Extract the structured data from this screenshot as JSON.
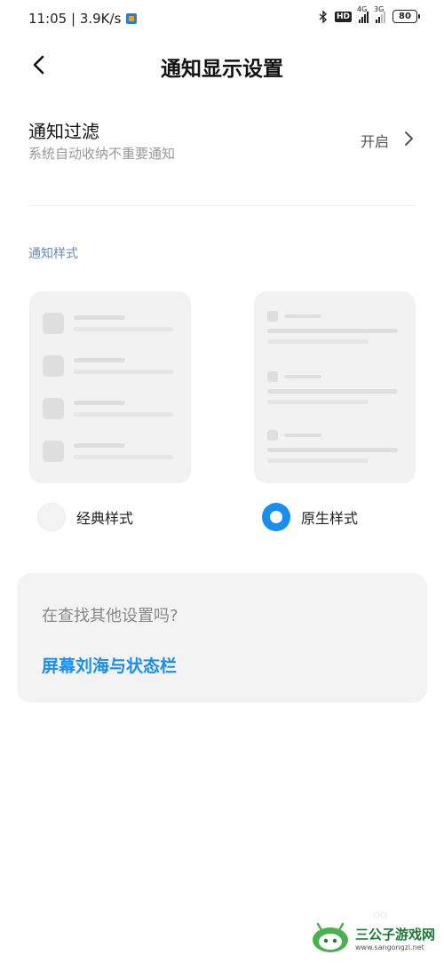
{
  "status_bar": {
    "time_speed": "11:05 | 3.9K/s",
    "hd": "HD",
    "net1": "4G",
    "net2": "3G",
    "battery": "80"
  },
  "header": {
    "title": "通知显示设置"
  },
  "filter_row": {
    "title": "通知过滤",
    "subtitle": "系统自动收纳不重要通知",
    "value": "开启"
  },
  "style_section": {
    "label": "通知样式",
    "options": [
      {
        "label": "经典样式",
        "selected": false
      },
      {
        "label": "原生样式",
        "selected": true
      }
    ]
  },
  "hint": {
    "question": "在查找其他设置吗?",
    "link": "屏幕刘海与状态栏"
  },
  "watermark": {
    "name": "三公子游戏网",
    "url": "www.sangongzi.net"
  },
  "colors": {
    "accent": "#1a8ef0",
    "section_label": "#6d86b6"
  }
}
